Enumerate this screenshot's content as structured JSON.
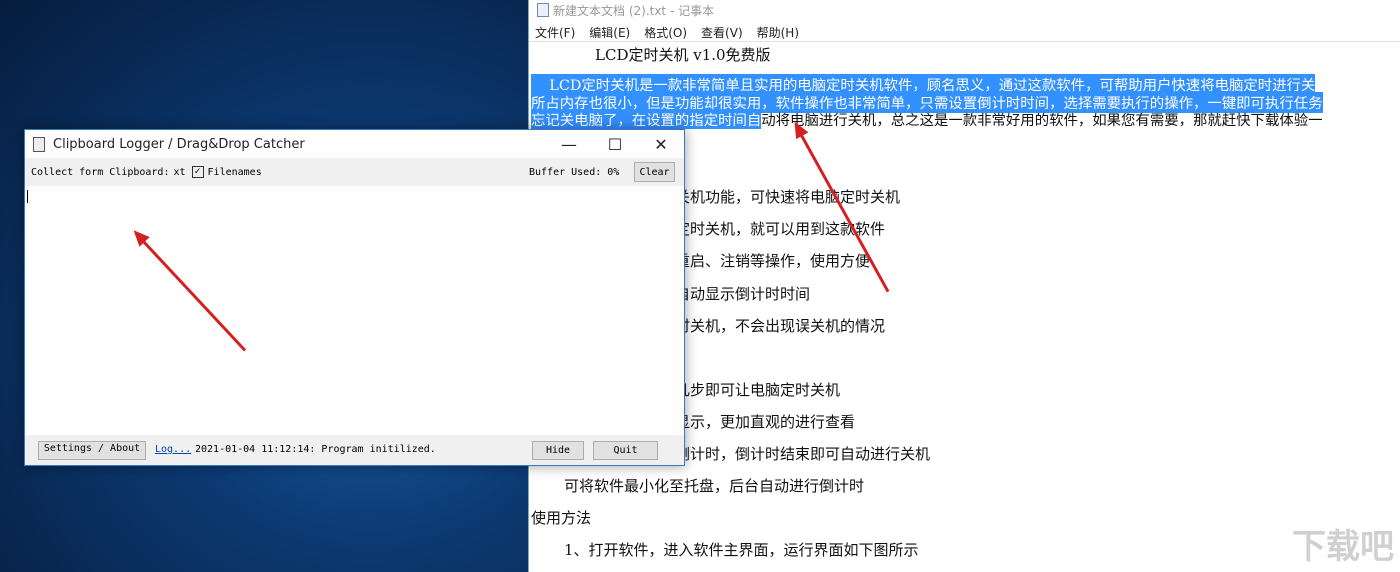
{
  "notepad": {
    "title": "新建文本文档 (2).txt - 记事本",
    "menu": [
      "文件(F)",
      "编辑(E)",
      "格式(O)",
      "查看(V)",
      "帮助(H)"
    ],
    "lines": {
      "heading": "LCD定时关机 v1.0免费版",
      "sel1": "    LCD定时关机是一款非常简单且实用的电脑定时关机软件，顾名思义，通过这款软件，可帮助用户快速将电脑定时进行关",
      "sel2": "所占内存也很小，但是功能却很实用，软件操作也非常简单，只需设置倒计时时间，选择需要执行的操作，一键即可执行任务",
      "sel3": "忘记关电脑了，在设置的指定时间自",
      "rest3": "动将电脑进行关机，总之这是一款非常好用的软件，如果您有需要，那就赶快下载体验一",
      "f1": "关机功能，可快速将电脑定时关机",
      "f2": "定时关机，就可以用到这款软件",
      "f3": "重启、注销等操作，使用方便",
      "f4": "自动显示倒计时时间",
      "f5": "时关机，不会出现误关机的情况",
      "f6": "几步即可让电脑定时关机",
      "f7": "显示，更加直观的进行查看",
      "f8": "倒计时，倒计时结束即可自动进行关机",
      "l9": "可将软件最小化至托盘，后台自动进行倒计时",
      "l10": "使用方法",
      "l11": "1、打开软件，进入软件主界面，运行界面如下图所示"
    }
  },
  "clipboard": {
    "title": "Clipboard Logger / Drag&Drop Catcher",
    "collect_label": "Collect form Clipboard:",
    "txt_label": "xt",
    "filenames_label": "Filenames",
    "filenames_checked": true,
    "buffer_label": "Buffer Used: 0%",
    "clear": "Clear",
    "settings": "Settings / About",
    "log_link": "Log...",
    "status": "2021-01-04 11:12:14: Program initilized.",
    "hide": "Hide",
    "quit": "Quit",
    "minimize": "—",
    "maximize": "☐",
    "close": "✕"
  },
  "watermark": "下载吧",
  "colors": {
    "selection": "#3390ff",
    "arrow": "#d42020",
    "window_border": "#3a78c2"
  }
}
